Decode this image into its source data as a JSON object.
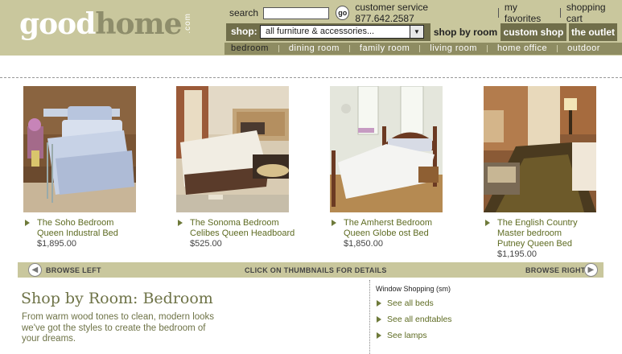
{
  "header": {
    "logo_good": "good",
    "logo_home": "home",
    "logo_com": ".com",
    "search_label": "search",
    "search_value": "",
    "go_label": "go",
    "customer_service": "customer service 877.642.2587",
    "favorites": "my favorites",
    "cart": "shopping cart",
    "shop_label": "shop:",
    "shop_select_value": "all furniture & accessories...",
    "tab_shop_by_room": "shop by room",
    "tab_custom_shop": "custom shop",
    "tab_outlet": "the outlet",
    "rooms": [
      "bedroom",
      "dining room",
      "family room",
      "living room",
      "home office",
      "outdoor"
    ]
  },
  "products": [
    {
      "name_line1": "The Soho Bedroom",
      "name_line2": "Queen Industral Bed",
      "name_line3": "",
      "price": "$1,895.00"
    },
    {
      "name_line1": "The Sonoma Bedroom",
      "name_line2": "Celibes Queen Headboard",
      "name_line3": "",
      "price": "$525.00"
    },
    {
      "name_line1": "The Amherst Bedroom",
      "name_line2": "Queen Globe ost Bed",
      "name_line3": "",
      "price": "$1,850.00"
    },
    {
      "name_line1": "The English Country",
      "name_line2": "Master bedroom",
      "name_line3": "Putney Queen Bed",
      "price": "$1,195.00"
    }
  ],
  "browse": {
    "left": "BROWSE LEFT",
    "center": "CLICK ON THUMBNAILS FOR DETAILS",
    "right": "BROWSE RIGHT"
  },
  "room": {
    "title": "Shop by Room: Bedroom",
    "description": "From warm wood tones  to clean, modern looks we've got the styles to create the bedroom of your dreams."
  },
  "window_shopping": {
    "title": "Window Shopping (sm)",
    "items": [
      "See all beds",
      "See all endtables",
      "See lamps"
    ]
  },
  "colors": {
    "header_bg": "#c9c79d",
    "shopbar_bg": "#706e4a",
    "roombar_bg": "#8e8c62",
    "link_green": "#5e6b22",
    "title_olive": "#6e7347"
  }
}
